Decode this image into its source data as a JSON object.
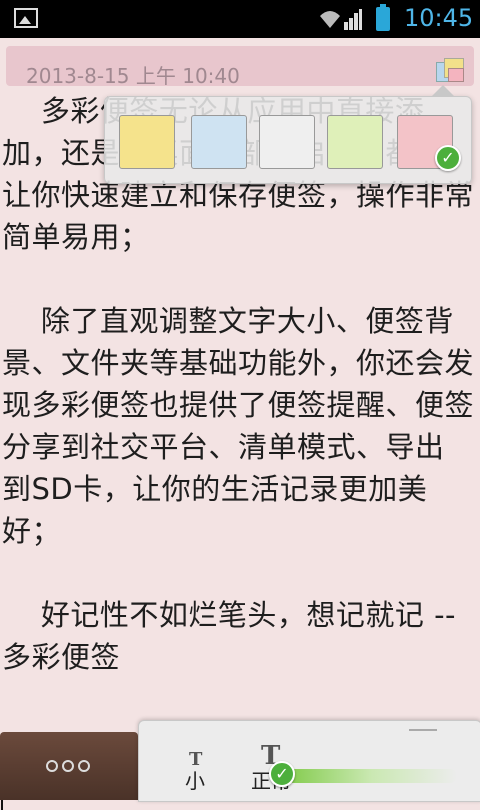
{
  "status_bar": {
    "time": "10:45"
  },
  "note": {
    "date": "2013-8-15 上午 10:40",
    "lines": [
      "    多彩便签无论从应用中直接添",
      "加，还是从桌面小部件启动，都能",
      "让你快速建立和保存便签，操作非常",
      "简单易用；",
      "",
      "    除了直观调整文字大小、便签背",
      "景、文件夹等基础功能外，你还会发",
      "现多彩便签也提供了便签提醒、便签",
      "分享到社交平台、清单模式、导出",
      "到SD卡，让你的生活记录更加美",
      "好；",
      "",
      "    好记性不如烂笔头，想记就记 --",
      "多彩便签"
    ]
  },
  "color_picker": {
    "swatches": [
      {
        "name": "yellow",
        "color": "#f5e38c",
        "selected": false
      },
      {
        "name": "blue",
        "color": "#cfe3f2",
        "selected": false
      },
      {
        "name": "white",
        "color": "#efefef",
        "selected": false
      },
      {
        "name": "green",
        "color": "#dff0b9",
        "selected": false
      },
      {
        "name": "red",
        "color": "#f3c3c8",
        "selected": true
      }
    ]
  },
  "bottom_bar": {
    "menu_icon": "more-dots-icon",
    "text_sizes": [
      {
        "label": "小",
        "glyph": "T",
        "selected": false
      },
      {
        "label": "正常",
        "glyph": "T",
        "selected": true
      }
    ]
  },
  "colors": {
    "note_background": "#f3e3e3",
    "header_pill": "#e8c6cd",
    "clock": "#4fb6e8"
  }
}
